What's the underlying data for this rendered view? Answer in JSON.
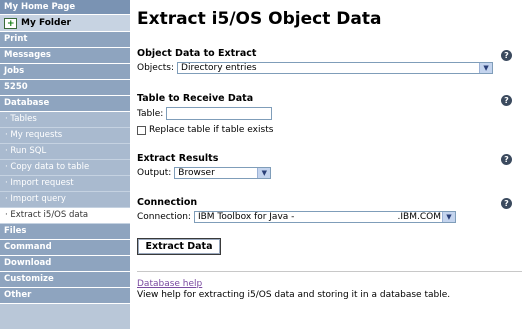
{
  "sidebar": {
    "header": "My Home Page",
    "folder": "My Folder",
    "sections": [
      {
        "label": "Print",
        "type": "sec"
      },
      {
        "label": "Messages",
        "type": "sec"
      },
      {
        "label": "Jobs",
        "type": "sec"
      },
      {
        "label": "5250",
        "type": "sec"
      },
      {
        "label": "Database",
        "type": "sec"
      },
      {
        "label": "· Tables",
        "type": "sub"
      },
      {
        "label": "· My requests",
        "type": "sub"
      },
      {
        "label": "· Run SQL",
        "type": "sub"
      },
      {
        "label": "· Copy data to table",
        "type": "sub"
      },
      {
        "label": "· Import request",
        "type": "sub"
      },
      {
        "label": "· Import query",
        "type": "sub"
      },
      {
        "label": "· Extract i5/OS data",
        "type": "sub",
        "active": true
      },
      {
        "label": "Files",
        "type": "sec"
      },
      {
        "label": "Command",
        "type": "sec"
      },
      {
        "label": "Download",
        "type": "sec"
      },
      {
        "label": "Customize",
        "type": "sec"
      },
      {
        "label": "Other",
        "type": "sec"
      }
    ]
  },
  "main": {
    "title": "Extract i5/OS Object Data",
    "object_section": {
      "title": "Object Data to Extract",
      "label": "Objects:",
      "value": "Directory entries"
    },
    "table_section": {
      "title": "Table to Receive Data",
      "label": "Table:",
      "value": "",
      "replace_label": "Replace table if table exists"
    },
    "results_section": {
      "title": "Extract Results",
      "label": "Output:",
      "value": "Browser"
    },
    "connection_section": {
      "title": "Connection",
      "label": "Connection:",
      "value_left": "IBM Toolbox for Java -",
      "value_right": ".IBM.COM"
    },
    "extract_button": "Extract Data",
    "help_link": "Database help",
    "help_desc": "View help for extracting i5/OS data and storing it in a database table.",
    "help_icon": "?"
  }
}
